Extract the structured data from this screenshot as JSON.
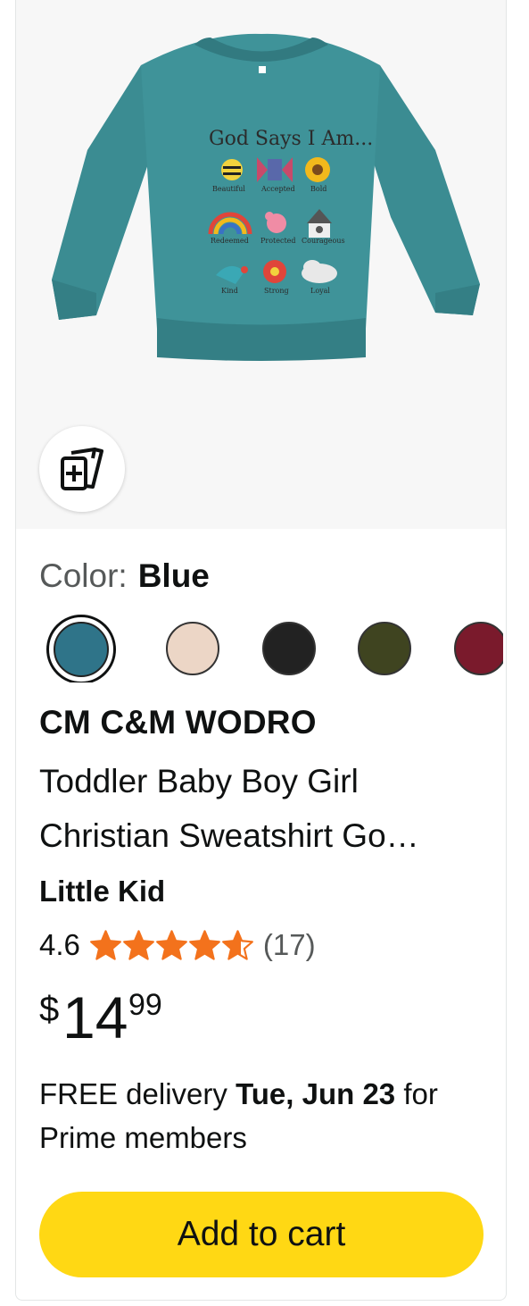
{
  "product": {
    "image_text": {
      "heading": "God Says I Am...",
      "words": [
        "Beautiful",
        "Accepted",
        "Bold",
        "Redeemed",
        "Protected",
        "Courageous",
        "Kind",
        "Strong",
        "Loyal"
      ]
    },
    "shirt_color": "#3b8c92",
    "compare_icon": "compare-cards-icon"
  },
  "color": {
    "label": "Color:",
    "value": "Blue",
    "swatches": [
      {
        "name": "Blue",
        "hex": "#2f7489",
        "selected": true
      },
      {
        "name": "Beige",
        "hex": "#ecd6c6"
      },
      {
        "name": "Black",
        "hex": "#222222"
      },
      {
        "name": "Olive",
        "hex": "#3f4420"
      },
      {
        "name": "Burgundy",
        "hex": "#7a1a2c"
      }
    ]
  },
  "brand": "CM C&M WODRO",
  "title_lines": [
    "Toddler Baby Boy Girl",
    "Christian Sweatshirt Go…"
  ],
  "subtitle": "Little Kid",
  "rating": {
    "value": "4.6",
    "count": "(17)",
    "stars": 4.6,
    "star_color": "#f3721c"
  },
  "price": {
    "symbol": "$",
    "whole": "14",
    "fraction": "99"
  },
  "delivery": {
    "prefix": "FREE delivery ",
    "date": "Tue, Jun 23",
    "suffix": " for Prime members"
  },
  "cart_button": {
    "label": "Add to cart",
    "color": "#ffd814"
  }
}
